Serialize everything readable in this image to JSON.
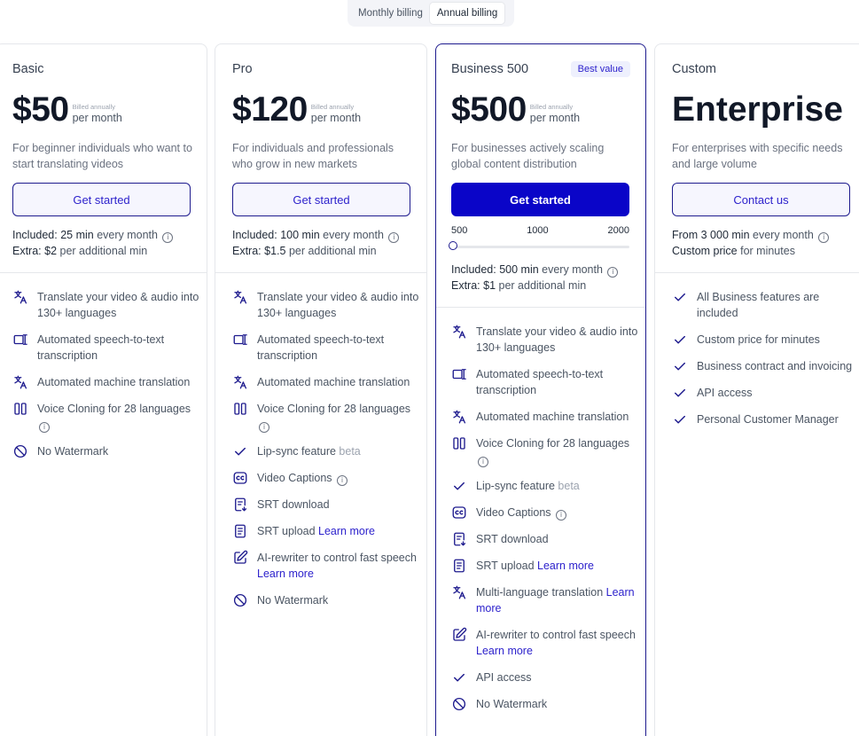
{
  "billing": {
    "monthly": "Monthly billing",
    "annual": "Annual billing"
  },
  "info_glyph": "i",
  "plans": [
    {
      "name": "Basic",
      "price": "$50",
      "billed": "Billed annually",
      "per": "per month",
      "desc": "For beginner individuals who want to start translating videos",
      "cta": "Get started",
      "included_label": "Included:",
      "included_value": "25 min",
      "included_suffix": "every month",
      "extra_label": "Extra:",
      "extra_value": "$2",
      "extra_suffix": "per additional min",
      "features": [
        {
          "icon": "translate-icon",
          "text": "Translate your video & audio into 130+ languages"
        },
        {
          "icon": "speech-to-text-icon",
          "text": "Automated speech-to-text transcription"
        },
        {
          "icon": "translate-icon",
          "text": "Automated machine translation"
        },
        {
          "icon": "voice-clone-icon",
          "text": "Voice Cloning for 28 languages",
          "info": true
        },
        {
          "icon": "no-watermark-icon",
          "text": "No Watermark"
        }
      ]
    },
    {
      "name": "Pro",
      "price": "$120",
      "billed": "Billed annually",
      "per": "per month",
      "desc": "For individuals and professionals who grow in new markets",
      "cta": "Get started",
      "included_label": "Included:",
      "included_value": "100 min",
      "included_suffix": "every month",
      "extra_label": "Extra:",
      "extra_value": "$1.5",
      "extra_suffix": "per additional min",
      "features": [
        {
          "icon": "translate-icon",
          "text": "Translate your video & audio into 130+ languages"
        },
        {
          "icon": "speech-to-text-icon",
          "text": "Automated speech-to-text transcription"
        },
        {
          "icon": "translate-icon",
          "text": "Automated machine translation"
        },
        {
          "icon": "voice-clone-icon",
          "text": "Voice Cloning for 28 languages",
          "info": true
        },
        {
          "icon": "check-icon",
          "text": "Lip-sync feature",
          "beta": "beta"
        },
        {
          "icon": "captions-icon",
          "text": "Video Captions",
          "info": true
        },
        {
          "icon": "srt-download-icon",
          "text": "SRT download"
        },
        {
          "icon": "srt-upload-icon",
          "text": "SRT upload",
          "link": "Learn more"
        },
        {
          "icon": "edit-icon",
          "text": "AI-rewriter to control fast speech",
          "link": "Learn more"
        },
        {
          "icon": "no-watermark-icon",
          "text": "No Watermark"
        }
      ]
    },
    {
      "name": "Business 500",
      "badge": "Best value",
      "price": "$500",
      "billed": "Billed annually",
      "per": "per month",
      "desc": "For businesses actively scaling global content distribution",
      "cta": "Get started",
      "slider": {
        "labels": [
          "500",
          "1000",
          "2000"
        ],
        "value": 0
      },
      "included_label": "Included:",
      "included_value": "500 min",
      "included_suffix": "every month",
      "extra_label": "Extra:",
      "extra_value": "$1",
      "extra_suffix": "per additional min",
      "features": [
        {
          "icon": "translate-icon",
          "text": "Translate your video & audio into 130+ languages"
        },
        {
          "icon": "speech-to-text-icon",
          "text": "Automated speech-to-text transcription"
        },
        {
          "icon": "translate-icon",
          "text": "Automated machine translation"
        },
        {
          "icon": "voice-clone-icon",
          "text": "Voice Cloning for 28 languages",
          "info": true
        },
        {
          "icon": "check-icon",
          "text": "Lip-sync feature",
          "beta": "beta"
        },
        {
          "icon": "captions-icon",
          "text": "Video Captions",
          "info": true
        },
        {
          "icon": "srt-download-icon",
          "text": "SRT download"
        },
        {
          "icon": "srt-upload-icon",
          "text": "SRT upload",
          "link": "Learn more"
        },
        {
          "icon": "translate-icon",
          "text": "Multi-language translation",
          "link": "Learn more"
        },
        {
          "icon": "edit-icon",
          "text": "AI-rewriter to control fast speech",
          "link": "Learn more"
        },
        {
          "icon": "check-icon",
          "text": "API access"
        },
        {
          "icon": "no-watermark-icon",
          "text": "No Watermark"
        }
      ]
    },
    {
      "name": "Custom",
      "title": "Enterprise",
      "desc": "For enterprises with specific needs and large volume",
      "cta": "Contact us",
      "included_label": "From",
      "included_value": "3 000 min",
      "included_suffix": "every month",
      "extra_label": "Custom price",
      "extra_value": "",
      "extra_suffix": "for minutes",
      "features": [
        {
          "icon": "check-icon",
          "text": "All Business features are included"
        },
        {
          "icon": "check-icon",
          "text": "Custom price for minutes"
        },
        {
          "icon": "check-icon",
          "text": "Business contract and invoicing"
        },
        {
          "icon": "check-icon",
          "text": "API access"
        },
        {
          "icon": "check-icon",
          "text": "Personal Customer Manager"
        }
      ]
    }
  ],
  "colors": {
    "accent": "#2d22cc",
    "primary_button": "#0a05c8",
    "border": "#e5e7eb"
  }
}
